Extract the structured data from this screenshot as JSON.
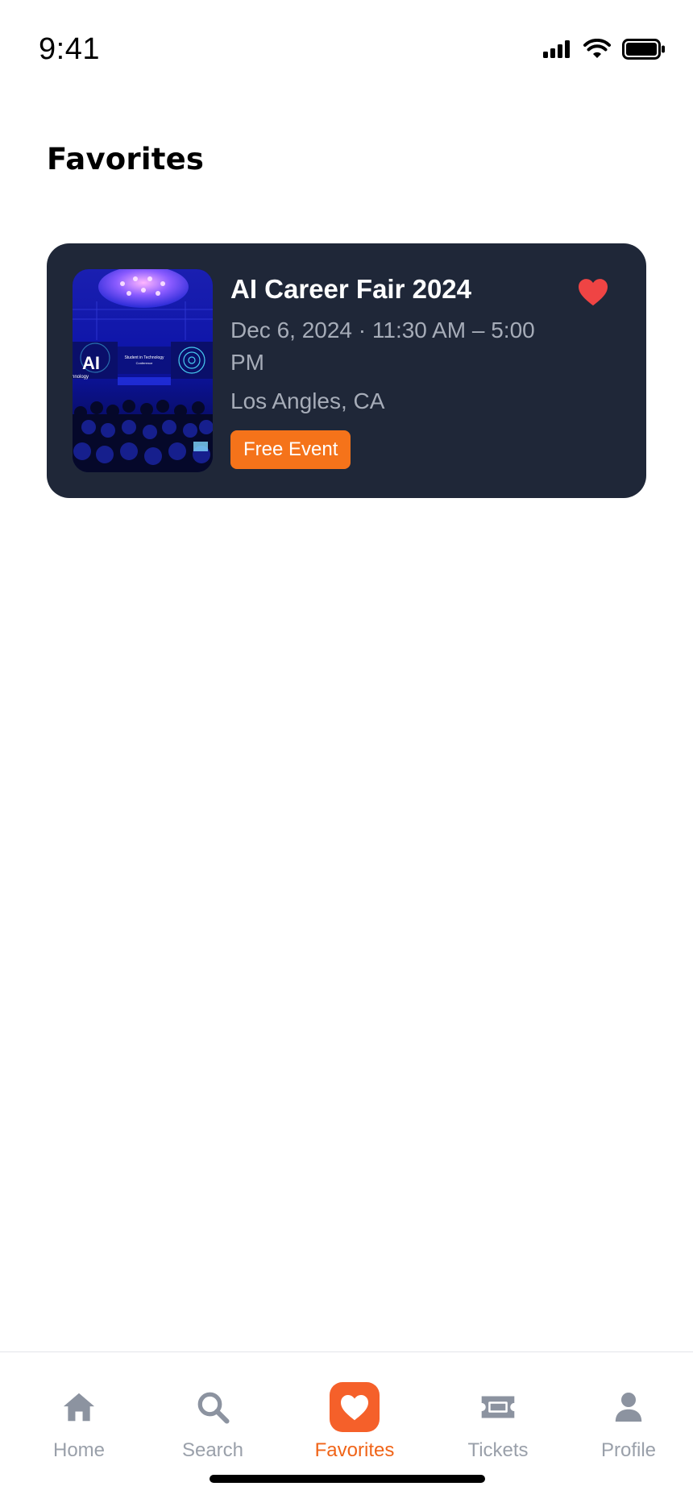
{
  "status_bar": {
    "time": "9:41"
  },
  "page": {
    "title": "Favorites"
  },
  "favorites": [
    {
      "title": "AI Career Fair 2024",
      "datetime": "Dec 6, 2024 · 11:30 AM – 5:00 PM",
      "location": "Los Angles, CA",
      "badge": "Free Event",
      "favorited": true,
      "image": {
        "logo_text": "AI",
        "screen_text_1": "Student in Technology",
        "screen_text_2": "Conference",
        "side_text": "chnology"
      }
    }
  ],
  "nav": {
    "items": [
      {
        "label": "Home",
        "icon": "home-icon",
        "active": false
      },
      {
        "label": "Search",
        "icon": "search-icon",
        "active": false
      },
      {
        "label": "Favorites",
        "icon": "heart-icon",
        "active": true
      },
      {
        "label": "Tickets",
        "icon": "ticket-icon",
        "active": false
      },
      {
        "label": "Profile",
        "icon": "profile-icon",
        "active": false
      }
    ]
  },
  "colors": {
    "card_bg": "#1f2738",
    "accent": "#f5731a",
    "heart": "#ef4444",
    "nav_active": "#f06418",
    "nav_inactive": "#9aa0aa"
  }
}
